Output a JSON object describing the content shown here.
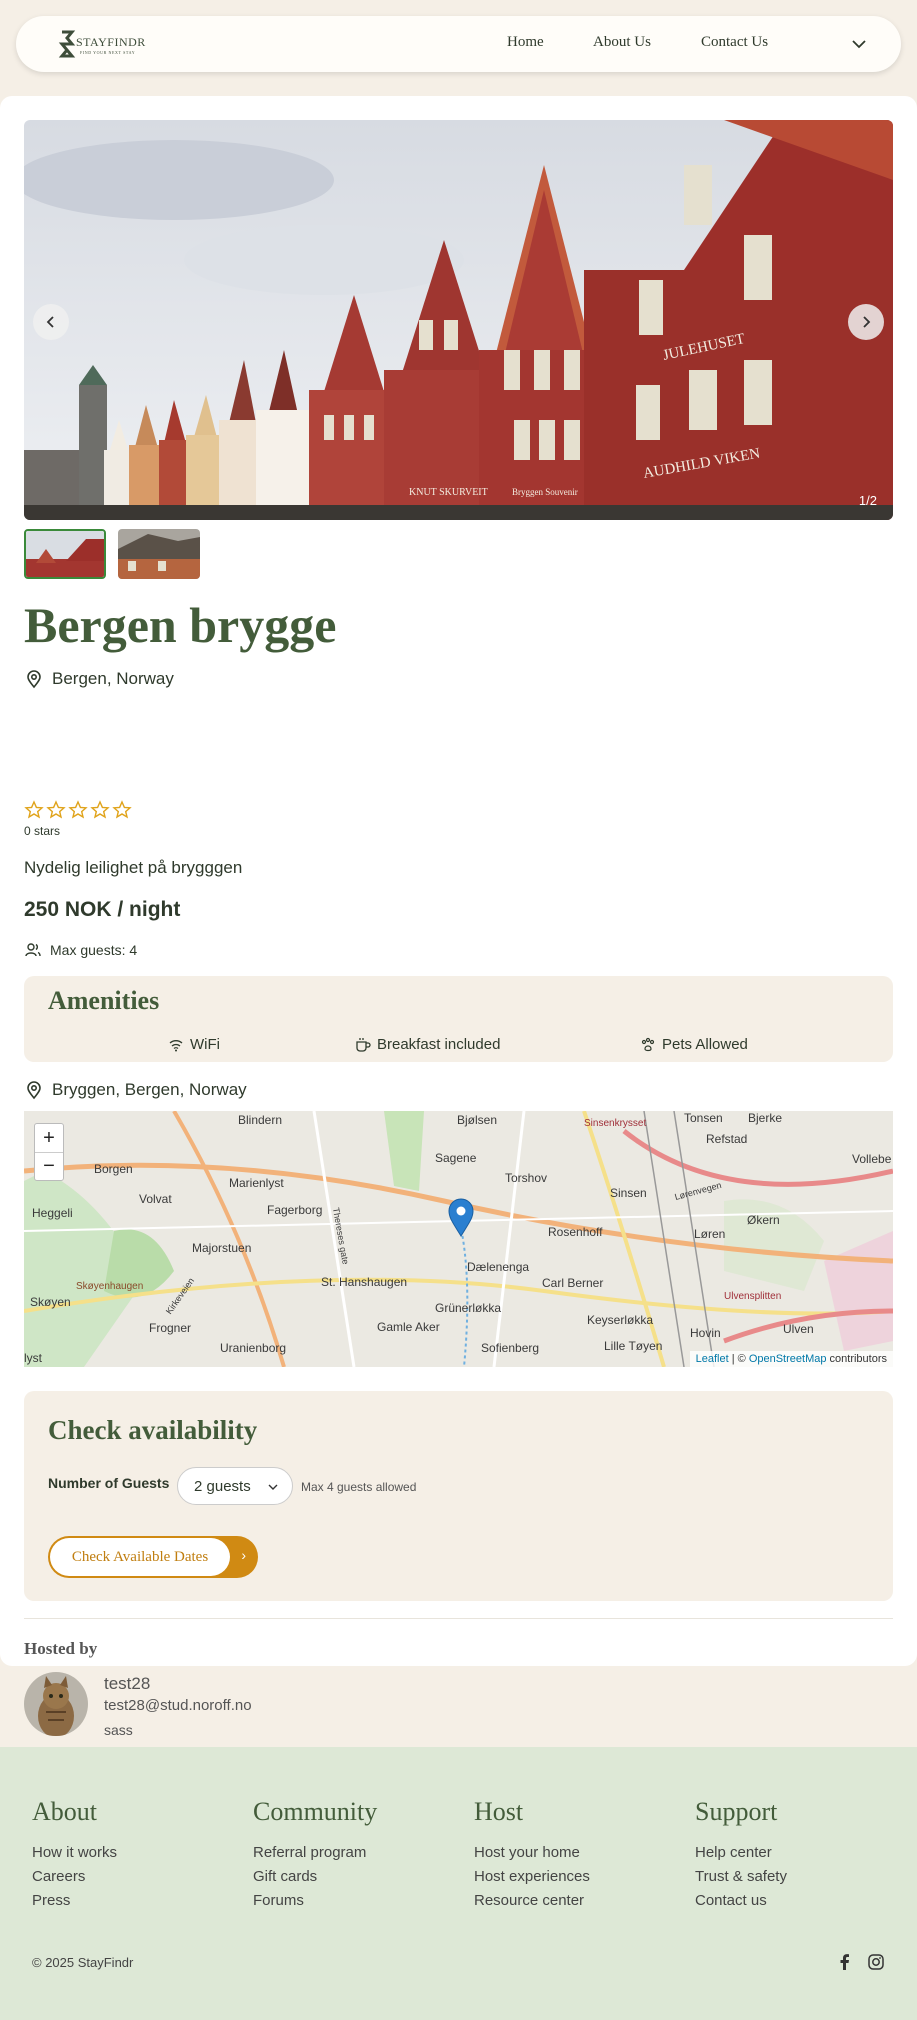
{
  "brand": {
    "name": "STAYFINDR",
    "tagline": "FIND YOUR NEXT STAY"
  },
  "nav": {
    "links": [
      "Home",
      "About Us",
      "Contact Us"
    ]
  },
  "listing": {
    "image_counter": "1/2",
    "title": "Bergen brygge",
    "location": "Bergen, Norway",
    "rating_stars": 0,
    "rating_label": "0 stars",
    "description": "Nydelig leilighet på brygggen",
    "price": "250 NOK / night",
    "max_guests": "Max guests: 4",
    "hero_signs": [
      "JULEHUSET",
      "AUDHILD VIKEN",
      "KNUT SKURVEIT",
      "Bryggen Souvenir"
    ]
  },
  "amenities": {
    "title": "Amenities",
    "items": [
      {
        "icon": "wifi-icon",
        "label": "WiFi"
      },
      {
        "icon": "coffee-icon",
        "label": "Breakfast included"
      },
      {
        "icon": "paw-icon",
        "label": "Pets Allowed"
      }
    ]
  },
  "address": "Bryggen, Bergen, Norway",
  "map": {
    "zoom_in": "+",
    "zoom_out": "−",
    "labels": [
      "Blindern",
      "Bjølsen",
      "Sinsenkrysset",
      "Tonsen",
      "Bjerke",
      "Refstad",
      "Vollebe",
      "Borgen",
      "Marienlyst",
      "Sagene",
      "Torshov",
      "Sinsen",
      "Volvat",
      "Fagerborg",
      "Heggeli",
      "Rosenhoff",
      "Løren",
      "Økern",
      "Majorstuen",
      "Dælenenga",
      "Skøyenhaugen",
      "St. Hanshaugen",
      "Carl Berner",
      "Skøyen",
      "Grünerløkka",
      "Keyserløkka",
      "Ulvensplitten",
      "Frogner",
      "Gamle Aker",
      "Hovin",
      "Ulven",
      "Uranienborg",
      "Sofienberg",
      "Lille Tøyen",
      "lyst",
      "Thereses gate",
      "Kirkeveien",
      "Lørenvegen"
    ],
    "attribution": {
      "leaflet": "Leaflet",
      "sep": " | © ",
      "osm": "OpenStreetMap",
      "suffix": " contributors"
    }
  },
  "availability": {
    "title": "Check availability",
    "guests_label": "Number of Guests",
    "guests_value": "2 guests",
    "guests_note": "Max 4 guests allowed",
    "button": "Check Available Dates",
    "button_arrow": "›"
  },
  "host": {
    "heading": "Hosted by",
    "name": "test28",
    "email": "test28@stud.noroff.no",
    "bio": "sass"
  },
  "footer": {
    "columns": [
      {
        "title": "About",
        "links": [
          "How it works",
          "Careers",
          "Press"
        ]
      },
      {
        "title": "Community",
        "links": [
          "Referral program",
          "Gift cards",
          "Forums"
        ]
      },
      {
        "title": "Host",
        "links": [
          "Host your home",
          "Host experiences",
          "Resource center"
        ]
      },
      {
        "title": "Support",
        "links": [
          "Help center",
          "Trust & safety",
          "Contact us"
        ]
      }
    ],
    "copyright": "© 2025 StayFindr",
    "social": [
      "facebook-icon",
      "instagram-icon"
    ]
  },
  "colors": {
    "accent_green": "#435c3a",
    "button_orange": "#d08a13",
    "star_gold": "#e0a31a",
    "footer_bg": "#dde8d6",
    "cream": "#f5efe6"
  }
}
